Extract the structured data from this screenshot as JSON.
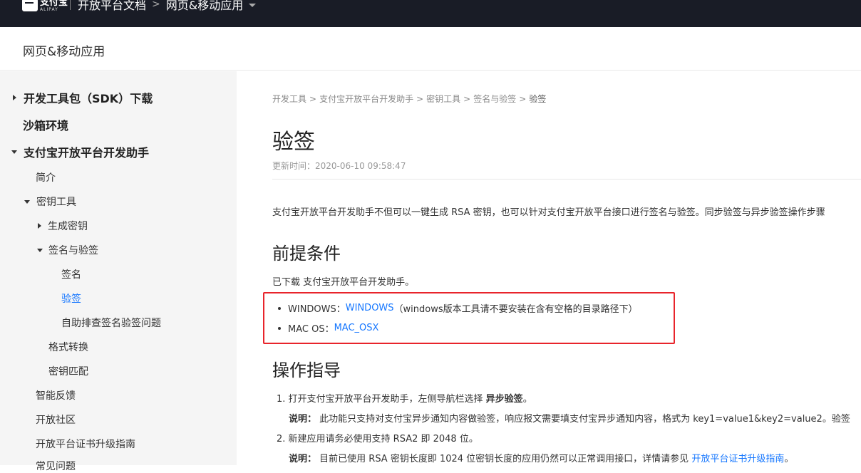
{
  "topbar": {
    "logo_cn": "支付宝",
    "logo_en": "ALIPAY",
    "nav_docs": "开放平台文档",
    "nav_arrow": ">",
    "nav_current": "网页&移动应用"
  },
  "subheader": {
    "title": "网页&移动应用"
  },
  "sidebar": {
    "sdk": "开发工具包（SDK）下载",
    "sandbox": "沙箱环境",
    "assistant": "支付宝开放平台开发助手",
    "intro": "简介",
    "key_tools": "密钥工具",
    "gen_key": "生成密钥",
    "sign_verify": "签名与验签",
    "sign": "签名",
    "verify": "验签",
    "troubleshoot": "自助排查签名验签问题",
    "format_convert": "格式转换",
    "key_match": "密钥匹配",
    "feedback": "智能反馈",
    "community": "开放社区",
    "cert_upgrade": "开放平台证书升级指南",
    "faq": "常见问题"
  },
  "content": {
    "breadcrumb": {
      "c1": "开发工具",
      "c2": "支付宝开放平台开发助手",
      "c3": "密钥工具",
      "c4": "签名与验签",
      "c5": "验签",
      "sep": ">"
    },
    "title": "验签",
    "updated": "更新时间：2020-06-10 09:58:47",
    "intro": "支付宝开放平台开发助手不但可以一键生成 RSA 密钥，也可以针对支付宝开放平台接口进行签名与验签。同步验签与异步验签操作步骤",
    "prereq_heading": "前提条件",
    "prereq_text": "已下载 支付宝开放平台开发助手。",
    "windows_label": "WINDOWS：",
    "windows_link": "WINDOWS",
    "windows_note": "（windows版本工具请不要安装在含有空格的目录路径下）",
    "mac_label": "MAC OS：",
    "mac_link": "MAC_OSX",
    "guide_heading": "操作指导",
    "step1_text": "1. 打开支付宝开放平台开发助手，左侧导航栏选择 ",
    "step1_bold": "异步验签",
    "step1_end": "。",
    "note_label": "说明：",
    "step1_note": " 此功能只支持对支付宝异步通知内容做验签，响应报文需要填支付宝异步通知内容，格式为 key1=value1&key2=value2。验签",
    "step2_text": "2. 新建应用请务必使用支持 RSA2 即 2048 位。",
    "step2_note": " 目前已使用 RSA 密钥长度即 1024 位密钥长度的应用仍然可以正常调用接口，详情请参见 ",
    "step2_link": "开放平台证书升级指南",
    "step2_end": "。"
  },
  "colors": {
    "topbar": "#191c26",
    "link": "#1677ff",
    "highlight_border": "#e8242b",
    "sidebar_bg": "#f5f5f5"
  }
}
